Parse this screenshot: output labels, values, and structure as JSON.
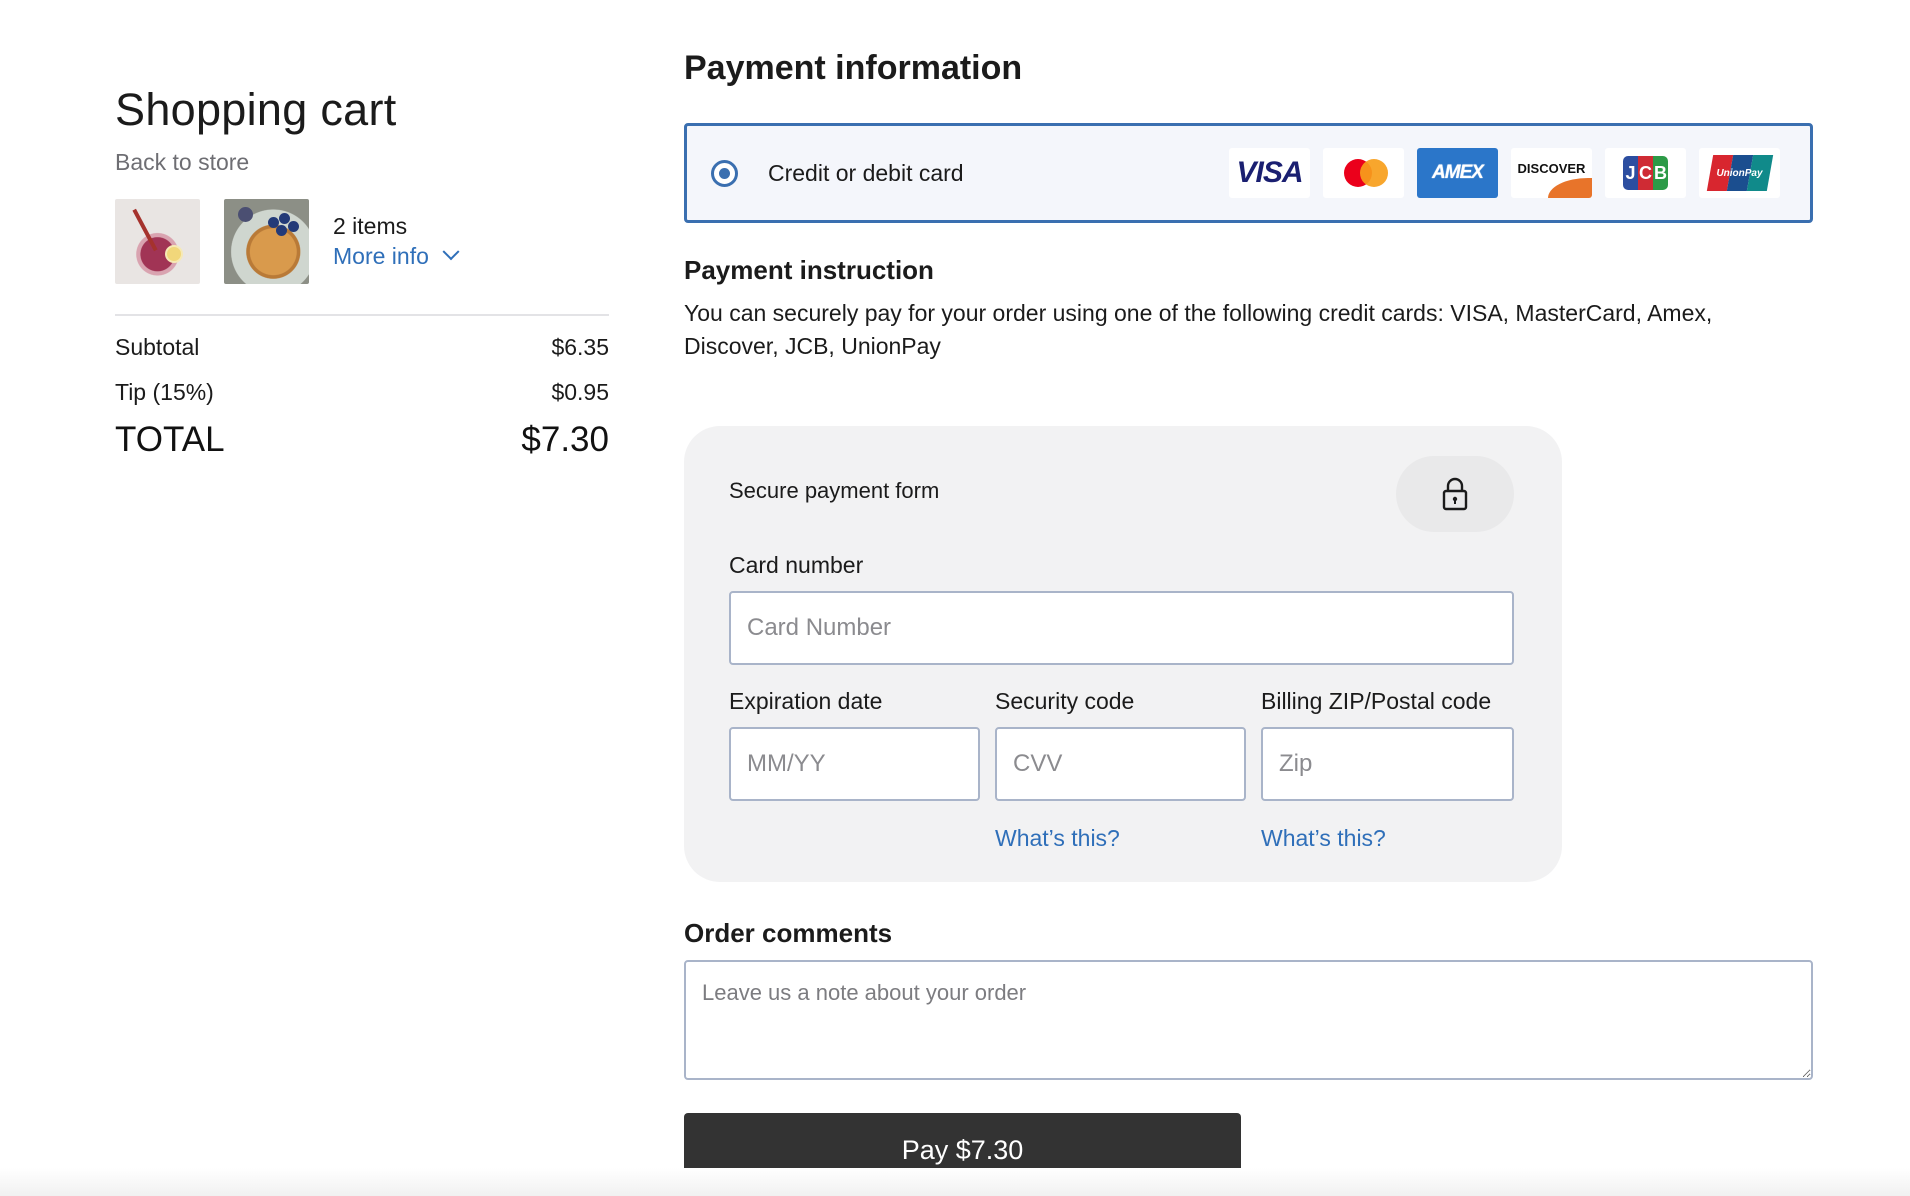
{
  "cart": {
    "title": "Shopping cart",
    "back_link": "Back to store",
    "items_count": "2 items",
    "more_info": "More info",
    "thumbnails": [
      {
        "name": "smoothie"
      },
      {
        "name": "pancakes"
      }
    ],
    "subtotal_label": "Subtotal",
    "subtotal_value": "$6.35",
    "tip_label": "Tip (15%)",
    "tip_value": "$0.95",
    "total_label": "TOTAL",
    "total_value": "$7.30"
  },
  "payment": {
    "title": "Payment information",
    "method_label": "Credit or debit card",
    "method_selected": true,
    "card_logos": [
      {
        "name": "visa-logo",
        "text": "VISA"
      },
      {
        "name": "mastercard-logo"
      },
      {
        "name": "amex-logo",
        "text": "AMEX"
      },
      {
        "name": "discover-logo",
        "text": "DISCOVER"
      },
      {
        "name": "jcb-logo",
        "text": "JCB"
      },
      {
        "name": "unionpay-logo",
        "text": "UnionPay"
      }
    ],
    "instruction_title": "Payment instruction",
    "instruction_text": "You can securely pay for your order using one of the following credit cards: VISA, MasterCard, Amex, Discover, JCB, UnionPay"
  },
  "secure_form": {
    "title": "Secure payment form",
    "lock_icon": "lock-icon",
    "card_number_label": "Card number",
    "card_number_placeholder": "Card Number",
    "card_number_value": "",
    "expiration_label": "Expiration date",
    "expiration_placeholder": "MM/YY",
    "security_label": "Security code",
    "security_placeholder": "CVV",
    "zip_label": "Billing ZIP/Postal code",
    "zip_placeholder": "Zip",
    "security_help": "What’s this?",
    "zip_help": "What’s this?"
  },
  "comments": {
    "title": "Order comments",
    "placeholder": "Leave us a note about your order"
  },
  "pay_button": "Pay $7.30",
  "colors": {
    "accent": "#3a6fb0",
    "link": "#2f6fb9",
    "button": "#333333",
    "card_bg": "#f2f2f3"
  }
}
